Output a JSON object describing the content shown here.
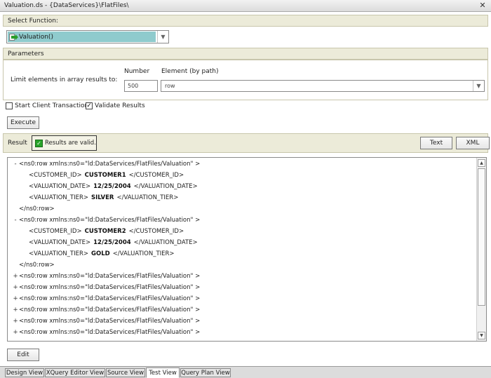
{
  "window": {
    "title": "Valuation.ds - {DataServices}\\FlatFiles\\"
  },
  "select_function": {
    "header": "Select Function:",
    "selected": "Valuation()"
  },
  "parameters": {
    "header": "Parameters",
    "limit_label": "Limit elements in array results to:",
    "number_label": "Number",
    "number_value": "500",
    "element_label": "Element (by path)",
    "element_value": "row"
  },
  "options": {
    "start_client_transaction": {
      "label": "Start Client Transaction",
      "checked": false
    },
    "validate_results": {
      "label": "Validate Results",
      "checked": true
    }
  },
  "execute_label": "Execute",
  "result": {
    "label": "Result",
    "status": "Results are valid.",
    "text_button": "Text",
    "xml_button": "XML"
  },
  "xml_lines": [
    {
      "toggle": "-",
      "indent": 0,
      "text": "<ns0:row xmlns:ns0=\"ld:DataServices/FlatFiles/Valuation\" >"
    },
    {
      "toggle": "",
      "indent": 1,
      "open": "<CUSTOMER_ID>",
      "value": "CUSTOMER1",
      "close": "</CUSTOMER_ID>"
    },
    {
      "toggle": "",
      "indent": 1,
      "open": "<VALUATION_DATE>",
      "value": "12/25/2004",
      "close": "</VALUATION_DATE>"
    },
    {
      "toggle": "",
      "indent": 1,
      "open": "<VALUATION_TIER>",
      "value": "SILVER",
      "close": "</VALUATION_TIER>"
    },
    {
      "toggle": "",
      "indent": 0,
      "text": "</ns0:row>"
    },
    {
      "toggle": "-",
      "indent": 0,
      "text": "<ns0:row xmlns:ns0=\"ld:DataServices/FlatFiles/Valuation\" >"
    },
    {
      "toggle": "",
      "indent": 1,
      "open": "<CUSTOMER_ID>",
      "value": "CUSTOMER2",
      "close": "</CUSTOMER_ID>"
    },
    {
      "toggle": "",
      "indent": 1,
      "open": "<VALUATION_DATE>",
      "value": "12/25/2004",
      "close": "</VALUATION_DATE>"
    },
    {
      "toggle": "",
      "indent": 1,
      "open": "<VALUATION_TIER>",
      "value": "GOLD",
      "close": "</VALUATION_TIER>"
    },
    {
      "toggle": "",
      "indent": 0,
      "text": "</ns0:row>"
    },
    {
      "toggle": "+",
      "indent": 0,
      "text": "<ns0:row xmlns:ns0=\"ld:DataServices/FlatFiles/Valuation\" >"
    },
    {
      "toggle": "+",
      "indent": 0,
      "text": "<ns0:row xmlns:ns0=\"ld:DataServices/FlatFiles/Valuation\" >"
    },
    {
      "toggle": "+",
      "indent": 0,
      "text": "<ns0:row xmlns:ns0=\"ld:DataServices/FlatFiles/Valuation\" >"
    },
    {
      "toggle": "+",
      "indent": 0,
      "text": "<ns0:row xmlns:ns0=\"ld:DataServices/FlatFiles/Valuation\" >"
    },
    {
      "toggle": "+",
      "indent": 0,
      "text": "<ns0:row xmlns:ns0=\"ld:DataServices/FlatFiles/Valuation\" >"
    },
    {
      "toggle": "+",
      "indent": 0,
      "text": "<ns0:row xmlns:ns0=\"ld:DataServices/FlatFiles/Valuation\" >"
    }
  ],
  "edit_label": "Edit",
  "tabs": [
    {
      "label": "Design View",
      "active": false
    },
    {
      "label": "XQuery Editor View",
      "active": false
    },
    {
      "label": "Source View",
      "active": false
    },
    {
      "label": "Test View",
      "active": true
    },
    {
      "label": "Query Plan View",
      "active": false
    }
  ]
}
